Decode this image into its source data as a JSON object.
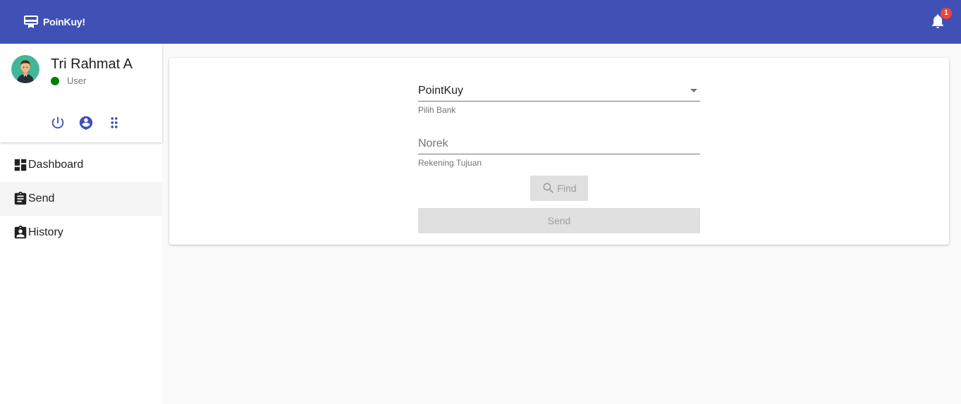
{
  "header": {
    "brand": "PoinKuy!",
    "brand_icon": "card-giftcard-icon",
    "notification_count": "1",
    "colors": {
      "primary": "#3f51b5",
      "badge": "#f44336"
    }
  },
  "profile": {
    "name": "Tri Rahmat A",
    "role": "User",
    "status_color": "#008000",
    "actions": [
      "power-icon",
      "account-pin-icon",
      "apps-grid-icon"
    ]
  },
  "nav": {
    "items": [
      {
        "label": "Dashboard",
        "icon": "dashboard-icon",
        "active": false
      },
      {
        "label": "Send",
        "icon": "assignment-icon",
        "active": true
      },
      {
        "label": "History",
        "icon": "assignment-ind-icon",
        "active": false
      }
    ]
  },
  "form": {
    "bank_select": {
      "value": "PointKuy",
      "helper": "Pilih Bank"
    },
    "account_input": {
      "value": "",
      "placeholder": "Norek",
      "helper": "Rekening Tujuan"
    },
    "find_label": "Find",
    "send_label": "Send"
  }
}
